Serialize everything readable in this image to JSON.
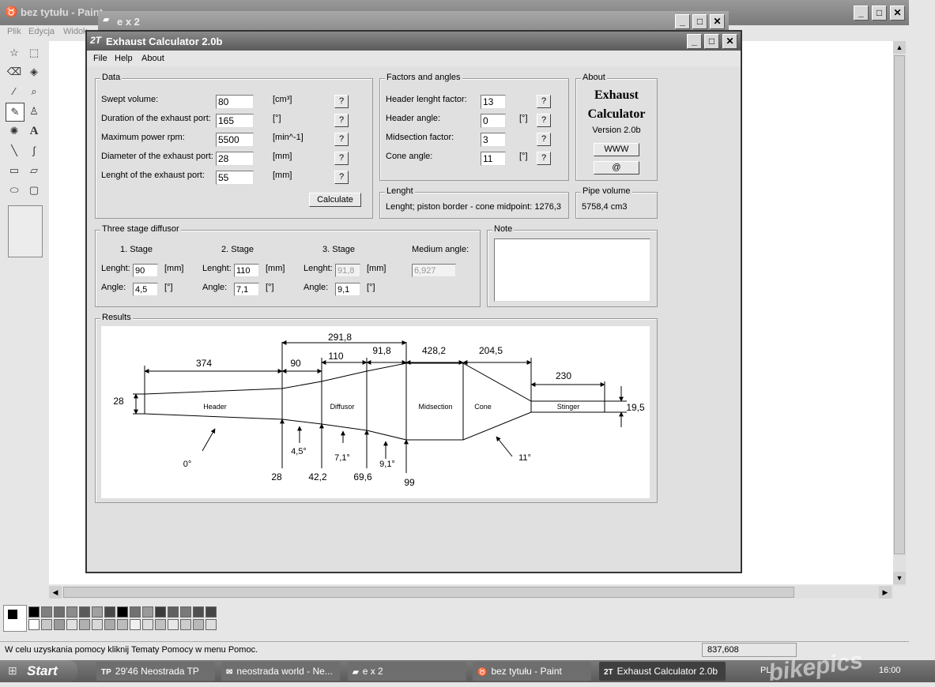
{
  "paint": {
    "title": "bez tytułu - Paint",
    "menu": [
      "Plik",
      "Edycja",
      "Widok"
    ],
    "status_help": "W celu uzyskania pomocy kliknij Tematy Pomocy w menu Pomoc.",
    "coords": "837,608"
  },
  "explorer_window": {
    "title": "e x 2"
  },
  "app": {
    "title": "Exhaust Calculator 2.0b",
    "logo": "2T",
    "menu": [
      "File",
      "Help",
      "About"
    ],
    "data": {
      "legend": "Data",
      "rows": [
        {
          "label": "Swept volume:",
          "value": "80",
          "unit": "[cm³]"
        },
        {
          "label": "Duration of the exhaust port:",
          "value": "165",
          "unit": "[°]"
        },
        {
          "label": "Maximum power rpm:",
          "value": "5500",
          "unit": "[min^-1]"
        },
        {
          "label": "Diameter of the exhaust port:",
          "value": "28",
          "unit": "[mm]"
        },
        {
          "label": "Lenght of the exhaust port:",
          "value": "55",
          "unit": "[mm]"
        }
      ],
      "help": "?",
      "calculate": "Calculate"
    },
    "factors": {
      "legend": "Factors and angles",
      "rows": [
        {
          "label": "Header lenght factor:",
          "value": "13",
          "unit": ""
        },
        {
          "label": "Header angle:",
          "value": "0",
          "unit": "[°]"
        },
        {
          "label": "Midsection factor:",
          "value": "3",
          "unit": ""
        },
        {
          "label": "Cone angle:",
          "value": "11",
          "unit": "[°]"
        }
      ]
    },
    "about": {
      "legend": "About",
      "line1": "Exhaust",
      "line2": "Calculator",
      "version": "Version 2.0b",
      "www": "WWW",
      "at": "@"
    },
    "lenght": {
      "legend": "Lenght",
      "text": "Lenght; piston border - cone midpoint:  1276,3"
    },
    "pipe": {
      "legend": "Pipe volume",
      "value": "5758,4 cm3"
    },
    "diffusor": {
      "legend": "Three stage diffusor",
      "stages": [
        {
          "title": "1. Stage",
          "lenght": "90",
          "angle": "4,5"
        },
        {
          "title": "2. Stage",
          "lenght": "110",
          "angle": "7,1"
        },
        {
          "title": "3. Stage",
          "lenght": "91,8",
          "angle": "9,1"
        }
      ],
      "lenght_label": "Lenght:",
      "angle_label": "Angle:",
      "mm": "[mm]",
      "deg": "[°]",
      "medium_label": "Medium angle:",
      "medium_value": "6,927"
    },
    "note": {
      "legend": "Note"
    },
    "results": {
      "legend": "Results",
      "dims": {
        "top_total": "291,8",
        "header_len": "374",
        "s1": "90",
        "s2": "110",
        "s3": "91,8",
        "mid": "428,2",
        "cone": "204,5",
        "stinger_len": "230",
        "inlet_d": "28",
        "stinger_d": "19,5"
      },
      "sections": [
        "Header",
        "Diffusor",
        "Midsection",
        "Cone",
        "Stinger"
      ],
      "angles": [
        "0°",
        "4,5°",
        "7,1°",
        "9,1°",
        "11°"
      ],
      "diameters": [
        "28",
        "42,2",
        "69,6",
        "99"
      ]
    }
  },
  "taskbar": {
    "start": "Start",
    "items": [
      "29'46 Neostrada TP",
      "neostrada world - Ne...",
      "e x 2",
      "bez tytułu - Paint",
      "Exhaust Calculator 2.0b"
    ],
    "tray_lang": "PL",
    "clock": "16:00",
    "watermark": "bikepics"
  }
}
